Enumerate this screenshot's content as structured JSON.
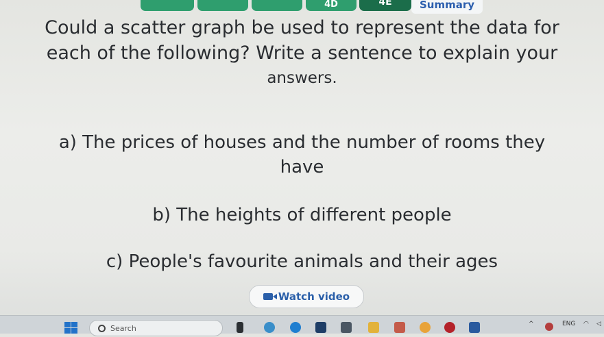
{
  "tabs": [
    "",
    "",
    "",
    "4D",
    "4E"
  ],
  "summary_tab": "Summary",
  "question": {
    "line1": "Could a scatter graph be used to represent the data for",
    "line2": "each of the following? Write a sentence to explain your",
    "line3": "answers."
  },
  "items": {
    "a_line1": "a) The prices of houses and the number of rooms they",
    "a_line2": "have",
    "b": "b) The heights of different people",
    "c": "c) People's favourite animals and their ages"
  },
  "watch_video": "Watch video",
  "taskbar": {
    "search_placeholder": "Search",
    "lang": "ENG",
    "icon_names": [
      "windows-logo",
      "search-icon",
      "file-explorer-icon",
      "edge-icon",
      "store-icon",
      "app-icon",
      "folder-icon",
      "app-icon",
      "chrome-icon",
      "app-icon",
      "word-icon"
    ]
  }
}
